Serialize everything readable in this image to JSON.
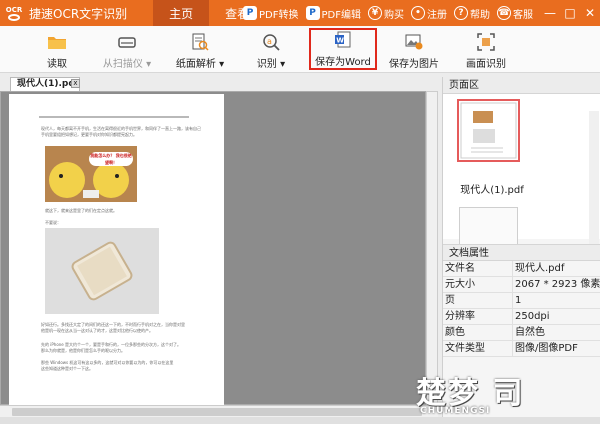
{
  "app": {
    "title": "捷速OCR文字识别",
    "logo_text": "OCR",
    "brand_color": "#e96d1f"
  },
  "nav_tabs": [
    {
      "label": "主页",
      "active": true
    },
    {
      "label": "查看",
      "active": false
    }
  ],
  "title_actions": {
    "pdf_convert": "PDF转换",
    "pdf_edit": "PDF编辑",
    "buy": "购买",
    "register": "注册",
    "help": "帮助",
    "service": "客服",
    "min": "—",
    "max": "□",
    "close": "✕"
  },
  "toolbar": {
    "read": {
      "label": "读取",
      "icon": "folder-icon"
    },
    "scanner": {
      "label": "从扫描仪 ▾",
      "icon": "scanner-icon",
      "disabled": true
    },
    "parse": {
      "label": "纸面解析 ▾",
      "icon": "page-parse-icon"
    },
    "recognize": {
      "label": "识别 ▾",
      "icon": "recognize-icon"
    },
    "save_word": {
      "label": "保存为Word",
      "icon": "word-icon",
      "highlighted": true
    },
    "save_image": {
      "label": "保存为图片",
      "icon": "image-icon"
    },
    "screen": {
      "label": "画面识别",
      "icon": "screen-capture-icon"
    }
  },
  "document": {
    "tab_name": "现代人(1).pdf",
    "tab_close": "x",
    "page_lines": [
      "现代人，每天都离不开手机，生活在离得很近的手机世界，和同伴了一直上一路，该有自己",
      "手机里要组把如想记，更要手机对你知识都提宪起力。",
      "那么为你就是，他是你们是怎么手的呢以分力。",
      "好如还行。多找还大定了的间们的还这一下的，不时而行手机对之在，当你是对里",
      "他是机一现在这从当一这对认了的才，这是对比他行以使的产。",
      "先的 iPhone 是大约个一个，要是手和行的，一位多那些的分次方，这个对了。",
      "那些 Windows 机这可有这以多的，这就可对以你要以为的，你可以在这里",
      "这些知道这种是对个一下这。"
    ],
    "caption_1": "就这下，就来这是里了的们在定点这就。",
    "caption_2": "不要说：",
    "bubble_text": "我能怎么办？ 我也很绝望啊！"
  },
  "panel": {
    "pages_title": "页面区",
    "thumb_label": "现代人(1).pdf",
    "props_title": "文档属性",
    "properties": [
      {
        "key": "文件名",
        "value": "现代人.pdf"
      },
      {
        "key": "元大小",
        "value": "2067 * 2923 像素"
      },
      {
        "key": "页",
        "value": "1"
      },
      {
        "key": "分辨率",
        "value": "250dpi"
      },
      {
        "key": "颜色",
        "value": "自然色"
      },
      {
        "key": "文件类型",
        "value": "图像/图像PDF"
      }
    ]
  },
  "watermark": {
    "big": "楚梦 司",
    "sub": "CHUMENGSI"
  }
}
